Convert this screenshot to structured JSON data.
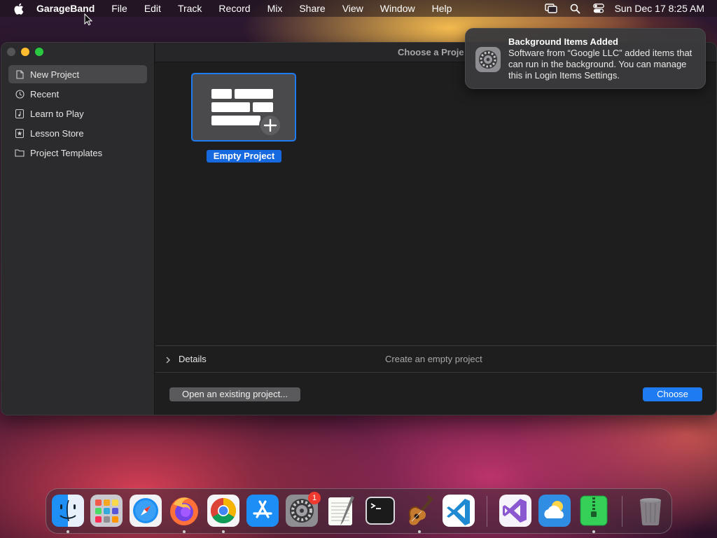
{
  "menubar": {
    "app_name": "GarageBand",
    "menus": [
      "File",
      "Edit",
      "Track",
      "Record",
      "Mix",
      "Share",
      "View",
      "Window",
      "Help"
    ],
    "clock": "Sun Dec 17  8:25 AM"
  },
  "window": {
    "title": "Choose a Proje",
    "sidebar": {
      "items": [
        {
          "label": "New Project",
          "icon": "document-icon",
          "selected": true
        },
        {
          "label": "Recent",
          "icon": "clock-icon"
        },
        {
          "label": "Learn to Play",
          "icon": "music-note-icon"
        },
        {
          "label": "Lesson Store",
          "icon": "star-icon"
        },
        {
          "label": "Project Templates",
          "icon": "folder-icon"
        }
      ]
    },
    "templates": [
      {
        "label": "Empty Project",
        "selected": true
      }
    ],
    "details": {
      "label": "Details",
      "description": "Create an empty project"
    },
    "buttons": {
      "open_existing": "Open an existing project...",
      "choose": "Choose"
    }
  },
  "notification": {
    "title": "Background Items Added",
    "body": "Software from “Google LLC” added items that can run in the background. You can manage this in Login Items Settings.",
    "icon": "system-settings-gear-icon"
  },
  "dock": {
    "apps": [
      {
        "name": "finder-icon",
        "running": true
      },
      {
        "name": "launchpad-icon",
        "running": false
      },
      {
        "name": "safari-icon",
        "running": false
      },
      {
        "name": "firefox-icon",
        "running": true
      },
      {
        "name": "chrome-icon",
        "running": true
      },
      {
        "name": "app-store-icon",
        "running": false
      },
      {
        "name": "system-settings-icon",
        "running": false,
        "badge": "1"
      },
      {
        "name": "textedit-icon",
        "running": false
      },
      {
        "name": "terminal-icon",
        "running": false
      },
      {
        "name": "garageband-icon",
        "running": true
      },
      {
        "name": "vscode-icon",
        "running": false
      },
      {
        "name": "visual-studio-icon",
        "running": false
      },
      {
        "name": "weather-icon",
        "running": false
      },
      {
        "name": "archive-utility-icon",
        "running": true
      },
      {
        "name": "trash-icon",
        "running": false
      }
    ]
  },
  "colors": {
    "accent": "#1f7bf1",
    "selection": "#1769e0",
    "close": "#545456",
    "minimize": "#febc2e",
    "maximize": "#28c840"
  }
}
